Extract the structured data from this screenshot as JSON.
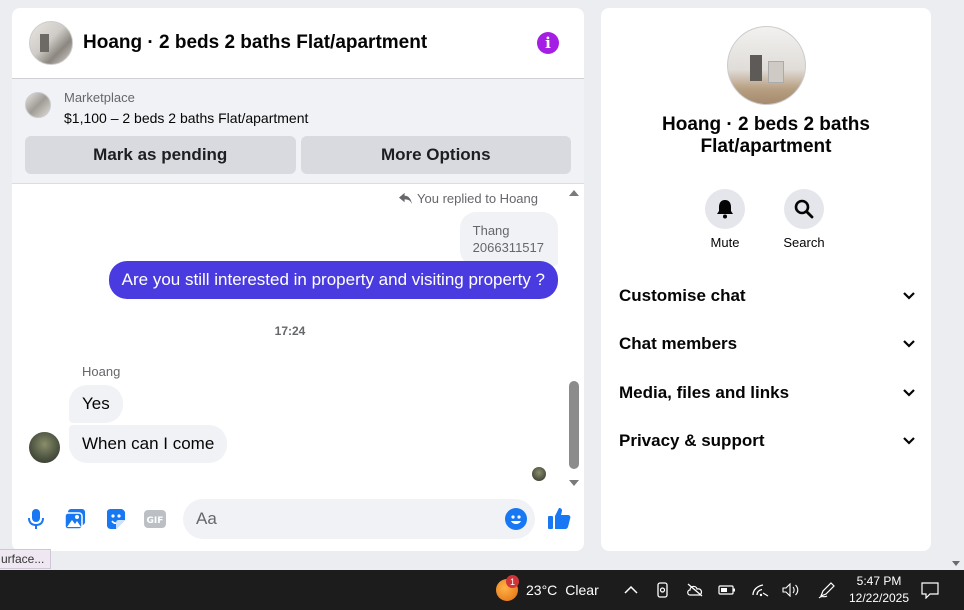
{
  "chat": {
    "title": "Hoang · 2 beds 2 baths Flat/apartment",
    "marketplace_label": "Marketplace",
    "listing": "$1,100 – 2 beds 2 baths Flat/apartment",
    "mark_pending": "Mark as pending",
    "more_options": "More Options"
  },
  "messages": {
    "replied_to": "You replied to Hoang",
    "quote_name": "Thang",
    "quote_text": "2066311517",
    "outgoing": "Are you still interested in property and visiting property ?",
    "time": "17:24",
    "sender": "Hoang",
    "incoming": [
      "Yes",
      "When can I come"
    ]
  },
  "composer": {
    "placeholder": "Aa"
  },
  "panel": {
    "name_line1": "Hoang · 2 beds 2 baths",
    "name_line2": "Flat/apartment",
    "mute": "Mute",
    "search": "Search",
    "menu": [
      "Customise chat",
      "Chat members",
      "Media, files and links",
      "Privacy & support"
    ]
  },
  "tooltip": "urface...",
  "taskbar": {
    "temperature": "23°C",
    "condition": "Clear",
    "weather_badge": "1",
    "time": "5:47 PM",
    "date": "12/22/2025"
  },
  "colors": {
    "brand_blue": "#1877f2",
    "outgoing_bubble": "#4a3be0",
    "info_purple": "#a41fe3"
  }
}
